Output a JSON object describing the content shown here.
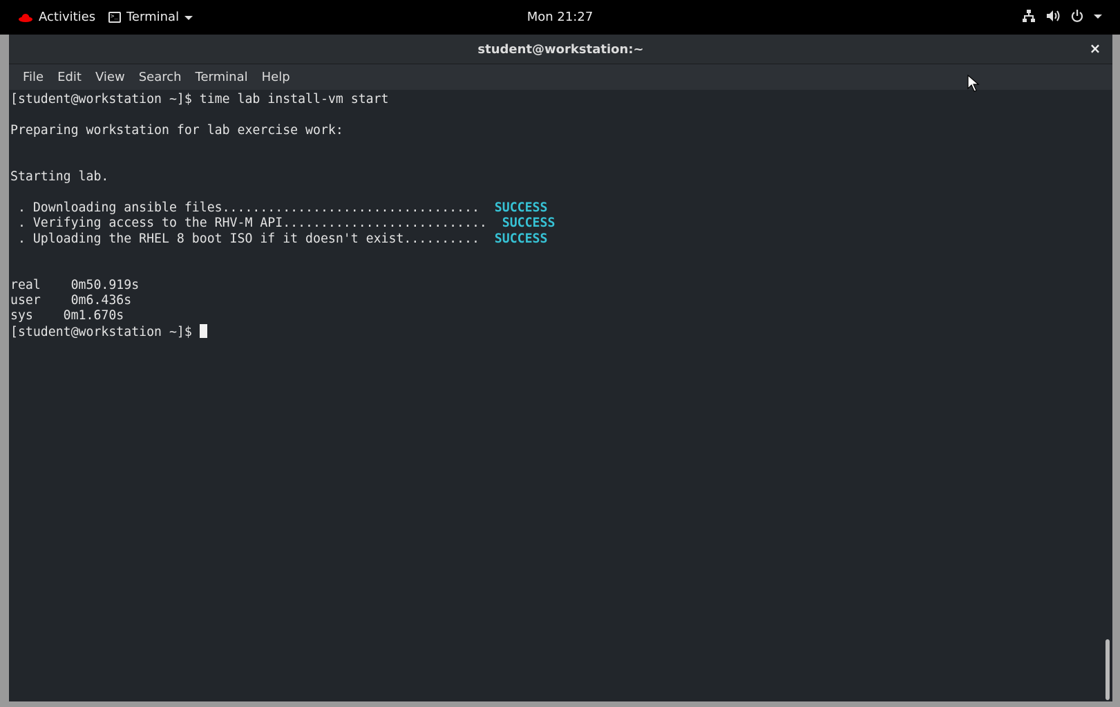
{
  "topbar": {
    "activities_label": "Activities",
    "app_label": "Terminal",
    "clock": "Mon 21:27",
    "status_icons": [
      "network-icon",
      "volume-icon",
      "power-icon",
      "chevron-down-icon"
    ]
  },
  "window": {
    "title": "student@workstation:~",
    "close_glyph": "×"
  },
  "menubar": {
    "items": [
      "File",
      "Edit",
      "View",
      "Search",
      "Terminal",
      "Help"
    ]
  },
  "terminal": {
    "lines": [
      {
        "text": "[student@workstation ~]$ time lab install-vm start"
      },
      {
        "text": ""
      },
      {
        "text": "Preparing workstation for lab exercise work:"
      },
      {
        "text": ""
      },
      {
        "text": ""
      },
      {
        "text": "Starting lab."
      },
      {
        "text": ""
      },
      {
        "text": " . Downloading ansible files..................................  ",
        "status": "SUCCESS"
      },
      {
        "text": " . Verifying access to the RHV-M API...........................  ",
        "status": "SUCCESS"
      },
      {
        "text": " . Uploading the RHEL 8 boot ISO if it doesn't exist..........  ",
        "status": "SUCCESS"
      },
      {
        "text": ""
      },
      {
        "text": ""
      },
      {
        "text": "real\t0m50.919s"
      },
      {
        "text": "user\t0m6.436s"
      },
      {
        "text": "sys\t0m1.670s"
      },
      {
        "text": "[student@workstation ~]$ ",
        "cursor": true
      }
    ],
    "colors": {
      "background": "#22262b",
      "foreground": "#e4e4e4",
      "success": "#37c3d6"
    }
  }
}
